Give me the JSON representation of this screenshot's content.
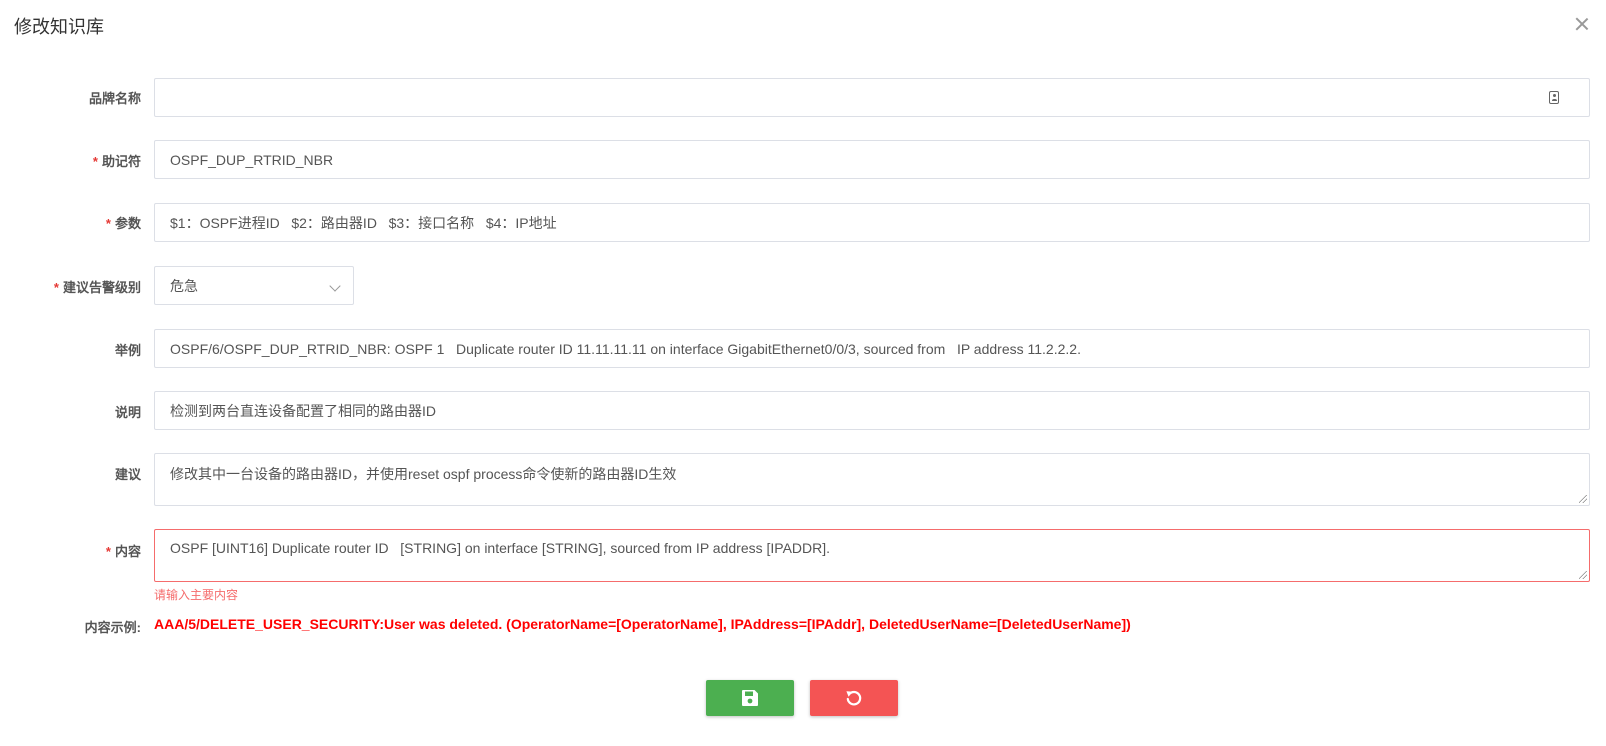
{
  "dialog": {
    "title": "修改知识库"
  },
  "form": {
    "brand": {
      "label": "品牌名称",
      "value": ""
    },
    "mnemonic": {
      "label": "助记符",
      "required_mark": "*",
      "value": "OSPF_DUP_RTRID_NBR"
    },
    "params": {
      "label": "参数",
      "required_mark": "*",
      "value": "$1：OSPF进程ID   $2：路由器ID   $3：接口名称   $4：IP地址"
    },
    "alarm_level": {
      "label": "建议告警级别",
      "required_mark": "*",
      "value": "危急"
    },
    "example": {
      "label": "举例",
      "value": "OSPF/6/OSPF_DUP_RTRID_NBR: OSPF 1   Duplicate router ID 11.11.11.11 on interface GigabitEthernet0/0/3, sourced from   IP address 11.2.2.2."
    },
    "description": {
      "label": "说明",
      "value": "检测到两台直连设备配置了相同的路由器ID"
    },
    "suggestion": {
      "label": "建议",
      "value": "修改其中一台设备的路由器ID，并使用reset ospf process命令使新的路由器ID生效"
    },
    "content": {
      "label": "内容",
      "required_mark": "*",
      "value": "OSPF [UINT16] Duplicate router ID   [STRING] on interface [STRING], sourced from IP address [IPADDR].",
      "error": "请输入主要内容"
    },
    "content_example": {
      "label": "内容示例:",
      "value": "AAA/5/DELETE_USER_SECURITY:User was deleted. (OperatorName=[OperatorName], IPAddress=[IPAddr], DeletedUserName=[DeletedUserName])"
    }
  },
  "buttons": {
    "save_icon": "save-icon",
    "reset_icon": "undo-icon"
  },
  "colors": {
    "save": "#4caf50",
    "reset": "#f45454",
    "error": "#f56c6c",
    "example": "#ff0000",
    "required": "#e53935"
  }
}
